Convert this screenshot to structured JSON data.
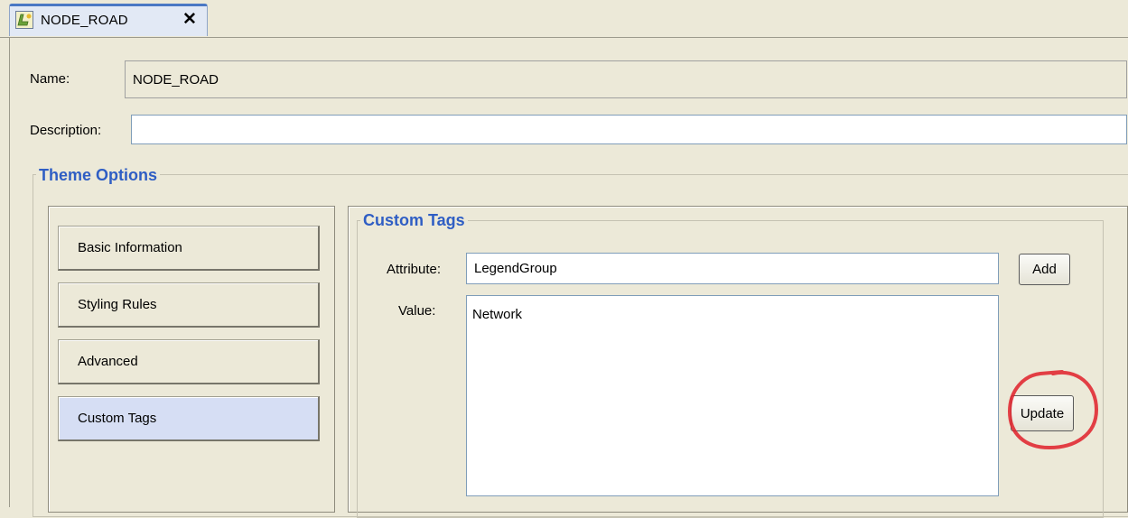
{
  "tab": {
    "label": "NODE_ROAD",
    "icon": "theme-icon",
    "close_icon": "close-icon",
    "close_glyph": "✕"
  },
  "form": {
    "name_label": "Name:",
    "name_value": "NODE_ROAD",
    "description_label": "Description:",
    "description_value": ""
  },
  "theme_options": {
    "legend": "Theme Options",
    "nav_items": [
      {
        "label": "Basic Information",
        "active": false
      },
      {
        "label": "Styling Rules",
        "active": false
      },
      {
        "label": "Advanced",
        "active": false
      },
      {
        "label": "Custom Tags",
        "active": true
      }
    ]
  },
  "custom_tags": {
    "legend": "Custom Tags",
    "attribute_label": "Attribute:",
    "attribute_value": "LegendGroup",
    "value_label": "Value:",
    "value_text": "Network",
    "add_label": "Add",
    "update_label": "Update"
  },
  "colors": {
    "background": "#ece9d8",
    "accent": "#2f5ec4",
    "highlight_circle": "#e0202a",
    "active_nav": "#d6def4"
  }
}
